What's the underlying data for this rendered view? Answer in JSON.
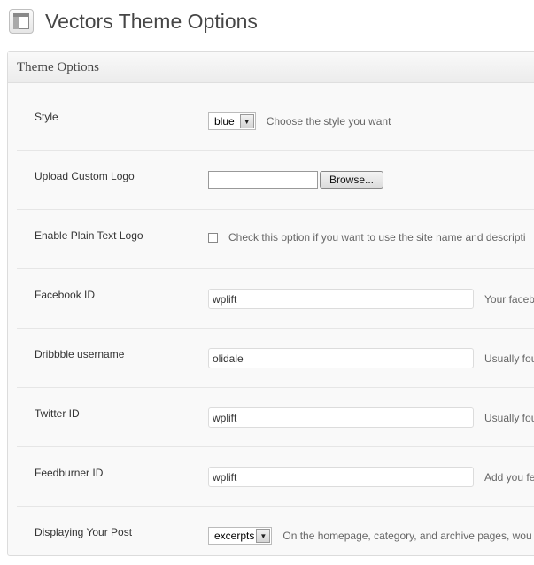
{
  "header": {
    "title": "Vectors Theme Options",
    "icon": "appearance-options-icon"
  },
  "panel": {
    "title": "Theme Options"
  },
  "fields": {
    "style": {
      "label": "Style",
      "selected": "blue",
      "hint": "Choose the style you want"
    },
    "logo": {
      "label": "Upload Custom Logo",
      "value": "",
      "button": "Browse..."
    },
    "plain_text_logo": {
      "label": "Enable Plain Text Logo",
      "checked": false,
      "hint": "Check this option if you want to use the site name and descripti"
    },
    "facebook": {
      "label": "Facebook ID",
      "value": "wplift",
      "hint": "Your faceb"
    },
    "dribbble": {
      "label": "Dribbble username",
      "value": "olidale",
      "hint": "Usually fou"
    },
    "twitter": {
      "label": "Twitter ID",
      "value": "wplift",
      "hint": "Usually fou"
    },
    "feedburner": {
      "label": "Feedburner ID",
      "value": "wplift",
      "hint": "Add you fe"
    },
    "display_post": {
      "label": "Displaying Your Post",
      "selected": "excerpts",
      "hint": "On the homepage, category, and archive pages, wou"
    }
  }
}
